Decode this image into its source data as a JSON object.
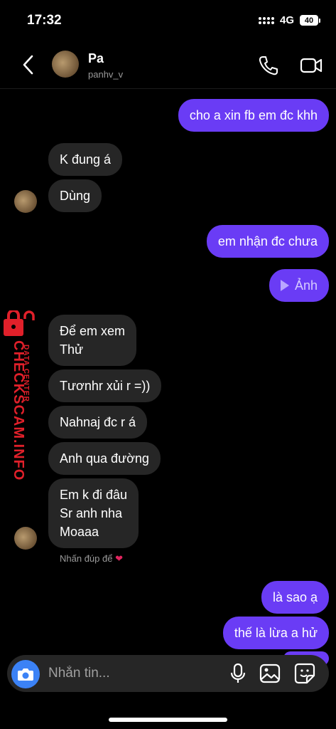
{
  "status": {
    "time": "17:32",
    "network": "4G",
    "battery": "40"
  },
  "header": {
    "name": "Pa",
    "username": "panhv_v",
    "icons": [
      "back-arrow-icon",
      "phone-icon",
      "video-camera-icon"
    ]
  },
  "messages": {
    "m1": "cho a xin fb em đc khh",
    "m2": "K đung á",
    "m3": "Dùng",
    "m4": "em nhận đc chưa",
    "m5": "Ảnh",
    "m6": "Để em xem\nThử",
    "m7": "Tươnhr xủi r =))",
    "m8": "Nahnaj đc r á",
    "m9": "Anh qua đường",
    "m10": "Em k đi đâu\nSr anh nha\nMoaaa",
    "m11": "là sao ạ",
    "m12": "thế là lừa a hử"
  },
  "hint": "Nhấn đúp để",
  "watermark": {
    "main": "CHECKSCAM.INFO",
    "sub": "DATA CENTER"
  },
  "composer": {
    "placeholder": "Nhắn tin...",
    "icons": [
      "camera-icon",
      "microphone-icon",
      "gallery-icon",
      "sticker-icon"
    ]
  },
  "colors": {
    "outgoing": "#6a3cf5",
    "incoming": "#262626",
    "accent": "#3b82f6",
    "watermark": "#e0202a"
  }
}
